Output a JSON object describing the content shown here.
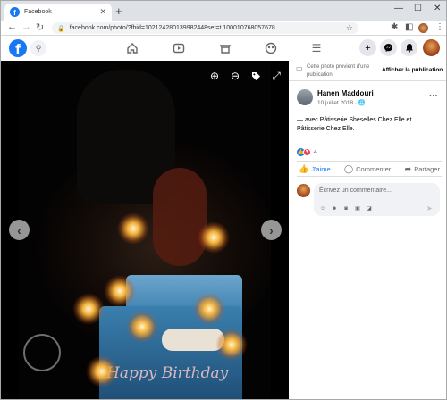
{
  "browser": {
    "tab_title": "Facebook",
    "url": "facebook.com/photo/?fbid=1021242801399824 4&set=t.100010768057678",
    "url_display": "facebook.com/photo/?fbid=102124280139982448set=t.100010768057678"
  },
  "viewer": {
    "cake_text": "Happy Birthday"
  },
  "panel": {
    "banner_text": "Cette photo provient d'une publication.",
    "banner_link": "Afficher la publication",
    "author": "Hanen Maddouri",
    "date": "10 juillet 2018",
    "caption": "— avec Pâtisserie Sheselles Chez Elle et Pâtisserie Chez Elle.",
    "reaction_count": "4",
    "like_label": "J'aime",
    "comment_label": "Commenter",
    "share_label": "Partager",
    "comment_placeholder": "Écrivez un commentaire..."
  },
  "colors": {
    "brand": "#1877f2",
    "love": "#f33e58"
  }
}
